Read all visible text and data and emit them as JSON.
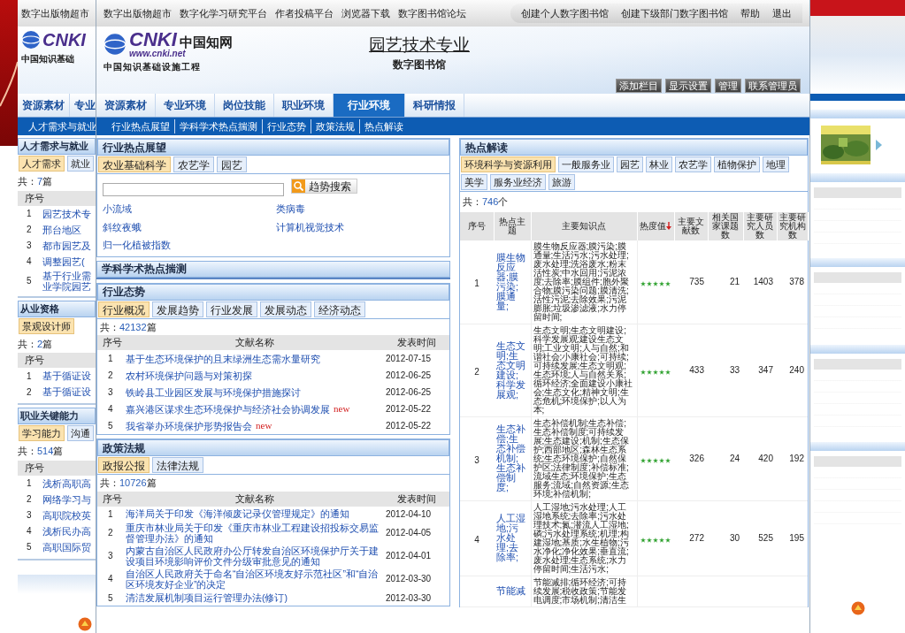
{
  "background_left": {
    "top_links": [
      "数字出版物超市"
    ],
    "logo": {
      "mark": "CNKI",
      "tagline": "中国知识基础"
    },
    "nav": [
      {
        "label": "资源素材",
        "selected": false
      },
      {
        "label": "专业",
        "selected": false
      }
    ],
    "subnav": [
      "人才需求与就业"
    ],
    "panels": [
      {
        "title": "人才需求与就业",
        "tabs": [
          {
            "label": "人才需求",
            "selected": true
          },
          {
            "label": "就业",
            "selected": false
          }
        ],
        "count_prefix": "共：",
        "count": "7",
        "count_suffix": "篇",
        "column_1": "序号",
        "rows": [
          {
            "index": "1",
            "title": "园艺技术专"
          },
          {
            "index": "2",
            "title": "邢台地区"
          },
          {
            "index": "3",
            "title": "都市园艺及"
          },
          {
            "index": "4",
            "title": "调整园艺("
          },
          {
            "index": "5",
            "title": "基于行业需业学院园艺"
          }
        ]
      },
      {
        "title": "从业资格",
        "tabs": [
          {
            "label": "景观设计师",
            "selected": true
          }
        ],
        "count_prefix": "共：",
        "count": "2",
        "count_suffix": "篇",
        "column_1": "序号",
        "rows": [
          {
            "index": "1",
            "title": "基于循证设"
          },
          {
            "index": "2",
            "title": "基于循证设"
          }
        ]
      },
      {
        "title": "职业关键能力",
        "tabs": [
          {
            "label": "学习能力",
            "selected": true
          },
          {
            "label": "沟通",
            "selected": false
          }
        ],
        "count_prefix": "共：",
        "count": "514",
        "count_suffix": "篇",
        "column_1": "序号",
        "rows": [
          {
            "index": "1",
            "title": "浅析高职高"
          },
          {
            "index": "2",
            "title": "网络学习与"
          },
          {
            "index": "3",
            "title": "高职院校英"
          },
          {
            "index": "4",
            "title": "浅析民办高"
          },
          {
            "index": "5",
            "title": "高职国际贸"
          }
        ]
      }
    ]
  },
  "top_links": [
    "数字出版物超市",
    "数字化学习研究平台",
    "作者投稿平台",
    "浏览器下载",
    "数字图书馆论坛"
  ],
  "account_links": [
    "创建个人数字图书馆",
    "创建下级部门数字图书馆",
    "帮助",
    "退出"
  ],
  "logo": {
    "mark": "CNKI",
    "chinese": "中国知网",
    "url": "www.cnki.net",
    "tagline": "中国知识基础设施工程"
  },
  "site_title": "园艺技术专业",
  "site_subtitle": "数字图书馆",
  "admin_buttons": [
    "添加栏目",
    "显示设置",
    "管理",
    "联系管理员"
  ],
  "nav": [
    {
      "label": "资源素材",
      "selected": false
    },
    {
      "label": "专业环境",
      "selected": false
    },
    {
      "label": "岗位技能",
      "selected": false
    },
    {
      "label": "职业环境",
      "selected": false
    },
    {
      "label": "行业环境",
      "selected": true
    },
    {
      "label": "科研情报",
      "selected": false
    }
  ],
  "subnav": [
    "行业热点展望",
    "学科学术热点揣测",
    "行业态势",
    "政策法规",
    "热点解读"
  ],
  "hot_outlook": {
    "title": "行业热点展望",
    "tabs": [
      {
        "label": "农业基础科学",
        "selected": true
      },
      {
        "label": "农艺学",
        "selected": false
      },
      {
        "label": "园艺",
        "selected": false
      }
    ],
    "search_button": "趋势搜索",
    "keywords": [
      "小流域",
      "类病毒",
      "斜纹夜蛾",
      "计算机视觉技术",
      "归一化植被指数"
    ]
  },
  "academic_forecast": {
    "title": "学科学术热点揣测"
  },
  "industry_trends": {
    "title": "行业态势",
    "tabs": [
      {
        "label": "行业概况",
        "selected": true
      },
      {
        "label": "发展趋势",
        "selected": false
      },
      {
        "label": "行业发展",
        "selected": false
      },
      {
        "label": "发展动态",
        "selected": false
      },
      {
        "label": "经济动态",
        "selected": false
      }
    ],
    "count_prefix": "共：",
    "count": "42132",
    "count_suffix": "篇",
    "columns": [
      "序号",
      "文献名称",
      "发表时间"
    ],
    "rows": [
      {
        "index": "1",
        "title": "基于生态环境保护的且末绿洲生态需水量研究",
        "date": "2012-07-15"
      },
      {
        "index": "2",
        "title": "农村环境保护问题与对策初探",
        "date": "2012-06-25"
      },
      {
        "index": "3",
        "title": "铁岭县工业园区发展与环境保护措施探讨",
        "date": "2012-06-25"
      },
      {
        "index": "4",
        "title": "嘉兴港区谋求生态环境保护与经济社会协调发展",
        "badge": "new",
        "date": "2012-05-22"
      },
      {
        "index": "5",
        "title": "我省举办环境保护形势报告会",
        "badge": "new",
        "date": "2012-05-22"
      }
    ]
  },
  "policy": {
    "title": "政策法规",
    "tabs": [
      {
        "label": "政报公报",
        "selected": true
      },
      {
        "label": "法律法规",
        "selected": false
      }
    ],
    "count_prefix": "共：",
    "count": "10726",
    "count_suffix": "篇",
    "columns": [
      "序号",
      "文献名称",
      "发表时间"
    ],
    "rows": [
      {
        "index": "1",
        "title": "海洋局关于印发《海洋倾废记录仪管理规定》的通知",
        "date": "2012-04-10"
      },
      {
        "index": "2",
        "title": "重庆市林业局关于印发《重庆市林业工程建设招投标交易监督管理办法》的通知",
        "date": "2012-04-05"
      },
      {
        "index": "3",
        "title": "内蒙古自治区人民政府办公厅转发自治区环境保护厅关于建设项目环境影响评价文件分级审批意见的通知",
        "date": "2012-04-01"
      },
      {
        "index": "4",
        "title": "自治区人民政府关于命名“自治区环境友好示范社区”和“自治区环境友好企业”的决定",
        "date": "2012-03-30"
      },
      {
        "index": "5",
        "title": "清洁发展机制项目运行管理办法(修订)",
        "date": "2012-03-30"
      }
    ]
  },
  "hot_reading": {
    "title": "热点解读",
    "tabs": [
      {
        "label": "环境科学与资源利用",
        "selected": true
      },
      {
        "label": "一般服务业",
        "selected": false
      },
      {
        "label": "园艺",
        "selected": false
      },
      {
        "label": "林业",
        "selected": false
      },
      {
        "label": "农艺学",
        "selected": false
      },
      {
        "label": "植物保护",
        "selected": false
      },
      {
        "label": "地理",
        "selected": false
      },
      {
        "label": "美学",
        "selected": false
      },
      {
        "label": "服务业经济",
        "selected": false
      },
      {
        "label": "旅游",
        "selected": false
      }
    ],
    "count_prefix": "共：",
    "count": "746",
    "count_suffix": "个",
    "columns": [
      {
        "label": "序号",
        "sorted": false
      },
      {
        "label": "热点主题",
        "sorted": false
      },
      {
        "label": "主要知识点",
        "sorted": false
      },
      {
        "label": "热度值",
        "sorted": true
      },
      {
        "label": "主要文献数",
        "sorted": false
      },
      {
        "label": "相关国家课题数",
        "sorted": false
      },
      {
        "label": "主要研究人员数",
        "sorted": false
      },
      {
        "label": "主要研究机构数",
        "sorted": false
      }
    ],
    "rows": [
      {
        "index": "1",
        "topic": "膜生物反应器;膜污染;膜通量;",
        "keywords": "膜生物反应器;膜污染;膜通量;生活污水;污水处理;废水处理;洗浴废水;粉末活性炭;中水回用;污泥浓度;去除率;膜组件;胞外聚合物;膜污染问题;膜清洗;活性污泥;去除效果;污泥膨胀;垃圾渗滤液;水力停留时间;",
        "stars": 5,
        "documents": "735",
        "projects": "21",
        "researchers": "1403",
        "institutions": "378"
      },
      {
        "index": "2",
        "topic": "生态文明;生态文明建设;科学发展观;",
        "keywords": "生态文明;生态文明建设;科学发展观;建设生态文明;工业文明;人与自然;和谐社会;小康社会;可持续;可持续发展;生态文明观;生态环境;人与自然关系;循环经济;全面建设小康社会;生态文化;精神文明;生态危机;环境保护;以人为本;",
        "stars": 5,
        "documents": "433",
        "projects": "33",
        "researchers": "347",
        "institutions": "240"
      },
      {
        "index": "3",
        "topic": "生态补偿;生态补偿机制;生态补偿制度;",
        "keywords": "生态补偿机制;生态补偿;生态补偿制度;可持续发展;生态建设;机制;生态保护;西部地区;森林生态系统;生态环境保护;自然保护区;法律制度;补偿标准;流域生态;环境保护;生态服务;流域;自然资源;生态环境;补偿机制;",
        "stars": 5,
        "documents": "326",
        "projects": "24",
        "researchers": "420",
        "institutions": "192"
      },
      {
        "index": "4",
        "topic": "人工湿地;污水处理;去除率;",
        "keywords": "人工湿地;污水处理;人工湿地系统;去除率;污水处理技术;氮;潜流人工湿地;磷;污水处理系统;机理;构建湿地;基质;水生植物;污水净化;净化效果;垂直流;废水处理;生态系统;水力停留时间;生活污水;",
        "stars": 5,
        "documents": "272",
        "projects": "30",
        "researchers": "525",
        "institutions": "195"
      },
      {
        "index": "",
        "topic": "节能减",
        "keywords": "节能减排;循环经济;可持续发展;税收政策;节能发电调度;市场机制;清洁生"
      }
    ]
  }
}
